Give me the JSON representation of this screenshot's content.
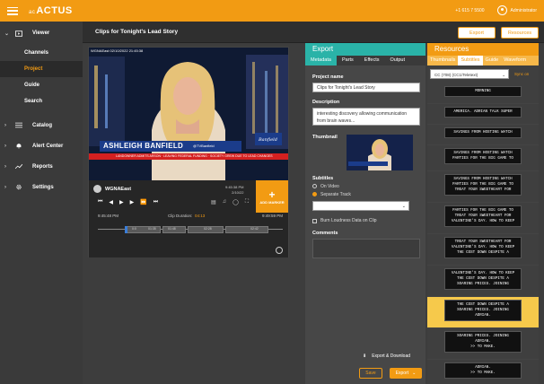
{
  "app": {
    "logo_text": "ACTUS",
    "logo_prefix": "ac",
    "phone": "+1 615 7 5500",
    "user": "Administrator"
  },
  "sidebar": {
    "items": [
      {
        "label": "Viewer",
        "icon": "play-box-icon",
        "expanded": true
      },
      {
        "label": "Catalog",
        "icon": "list-icon"
      },
      {
        "label": "Alert Center",
        "icon": "bell-icon"
      },
      {
        "label": "Reports",
        "icon": "trend-chart-icon"
      },
      {
        "label": "Settings",
        "icon": "gear-icon"
      }
    ],
    "viewer_subitems": [
      "Channels",
      "Project",
      "Guide",
      "Search"
    ],
    "active_subitem": "Project"
  },
  "header": {
    "clip_title": "Clips for Tonight's Lead Story",
    "export_button": "Export",
    "resources_button": "Resources"
  },
  "player": {
    "stamp": "WGNAEast 02/10/2022 21:45:38",
    "lower_third_name": "ASHLEIGH BANFIELD",
    "lower_third_handle": "@TVBanfield",
    "ticker": "LANDOWNER ADMITS ARSON · LEAVING FEDERAL FUNDING · SOCIETY GREW DUE TO LEAD CHANGES",
    "station": "WGNAEast",
    "time_top": "9:45:38 PM",
    "date_top": "2/10/22",
    "add_marker": "ADD MARKER",
    "clip_start": "9:45:48 PM",
    "clip_duration_label": "Clip Duration:",
    "clip_duration": "04:13",
    "clip_end": "9:49:59 PM",
    "segment_labels": [
      "0:0",
      "01:35",
      "01:48",
      "02:28",
      "02:42"
    ]
  },
  "export": {
    "title": "Export",
    "tabs": [
      "Metadata",
      "Parts",
      "Effects",
      "Output"
    ],
    "project_name_label": "Project name",
    "project_name_value": "Clips for Tonight's Lead Story",
    "description_label": "Description",
    "description_value": "interesting discovery allowing communication from brain waves...",
    "thumbnail_label": "Thumbnail",
    "subtitles_label": "Subtitles",
    "subtitle_options": [
      "On Video",
      "Separate Track"
    ],
    "selected_subtitle": "Separate Track",
    "burn_label": "Burn Loudness Data on Clip",
    "comments_label": "Comments",
    "export_download": "Export & Download",
    "save_button": "Save",
    "export_button": "Export"
  },
  "resources": {
    "title": "Resources",
    "tabs": [
      "Thumbnails",
      "Subtitles",
      "Guide",
      "Waveform"
    ],
    "active_tab": "Subtitles",
    "dropdown": "CC (708) (CC1/Teletext)",
    "sync_link": "Sync on",
    "captions": [
      "MORNING",
      "AMERICA. ADRIAN TALK SUPER",
      "SAVINGS FROM HOSTING WATCH",
      "SAVINGS FROM HOSTING WATCH\nPARTIES FOR THE BIG GAME TO",
      "SAVINGS FROM HOSTING WATCH\nPARTIES FOR THE BIG GAME TO\nTREAT YOUR SWEETHEART FOR",
      "PARTIES FOR THE BIG GAME TO\nTREAT YOUR SWEETHEART FOR\nVALENTINE'S DAY. HOW TO KEEP",
      "TREAT YOUR SWEETHEART FOR\nVALENTINE'S DAY. HOW TO KEEP\nTHE COST DOWN DESPITE A",
      "VALENTINE'S DAY. HOW TO KEEP\nTHE COST DOWN DESPITE A\nSOARING PRICES. JOINING",
      "THE COST DOWN DESPITE A\nSOARING PRICES. JOINING\nADRIAN.",
      "SOARING PRICES. JOINING\nADRIAN.\n>> TO MAKE.",
      "ADRIAN.\n>> TO MAKE."
    ],
    "highlighted_index": 8
  },
  "colors": {
    "accent": "#f29b13",
    "teal": "#2ab3a8",
    "highlight": "#f6c94b"
  }
}
